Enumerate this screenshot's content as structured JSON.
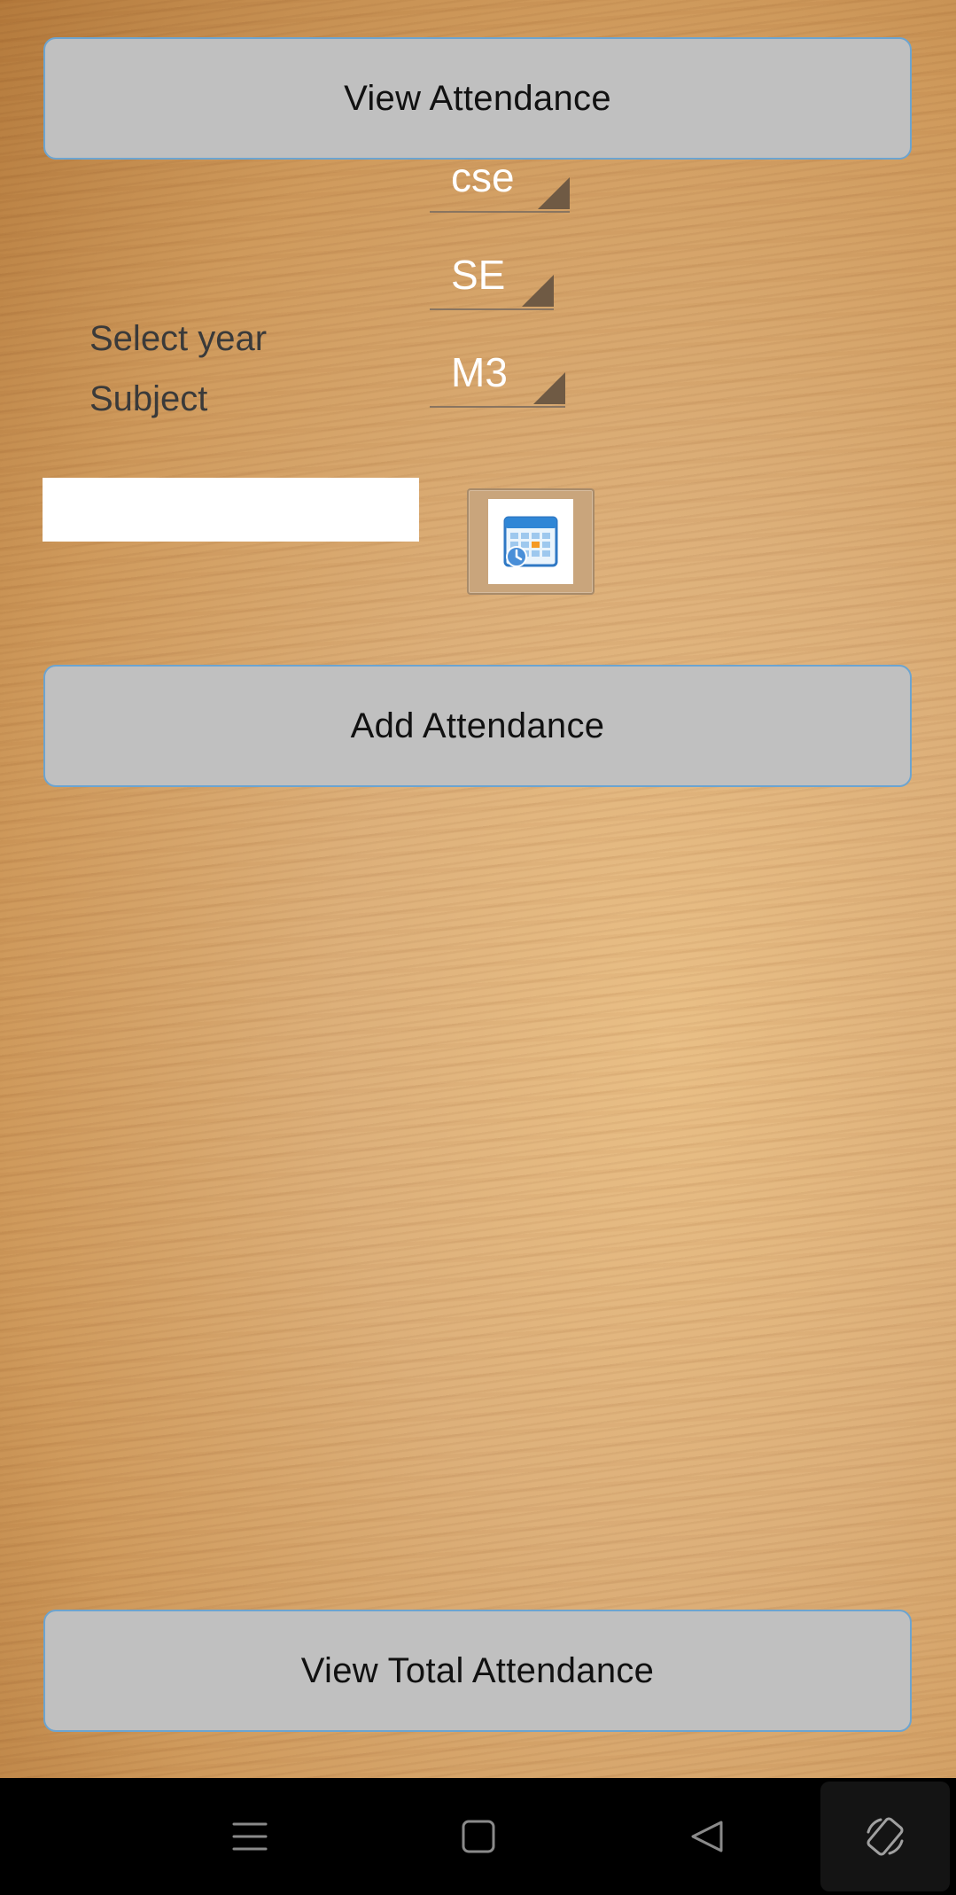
{
  "buttons": {
    "view_attendance": "View Attendance",
    "add_attendance": "Add Attendance",
    "view_total_attendance": "View Total Attendance"
  },
  "spinners": {
    "branch": "cse",
    "year": "SE",
    "subject": "M3"
  },
  "labels": {
    "select_year": "Select year",
    "subject": "Subject"
  },
  "date_field": {
    "value": ""
  },
  "icons": {
    "calendar": "calendar-icon",
    "nav_menu": "menu-icon",
    "nav_home": "home-square-icon",
    "nav_back": "back-triangle-icon",
    "nav_rotate": "rotate-screen-icon"
  },
  "colors": {
    "button_bg": "#c0c0c0",
    "button_border": "#6ca4d0",
    "spinner_text": "#ffffff",
    "navbar_bg": "#000000"
  }
}
